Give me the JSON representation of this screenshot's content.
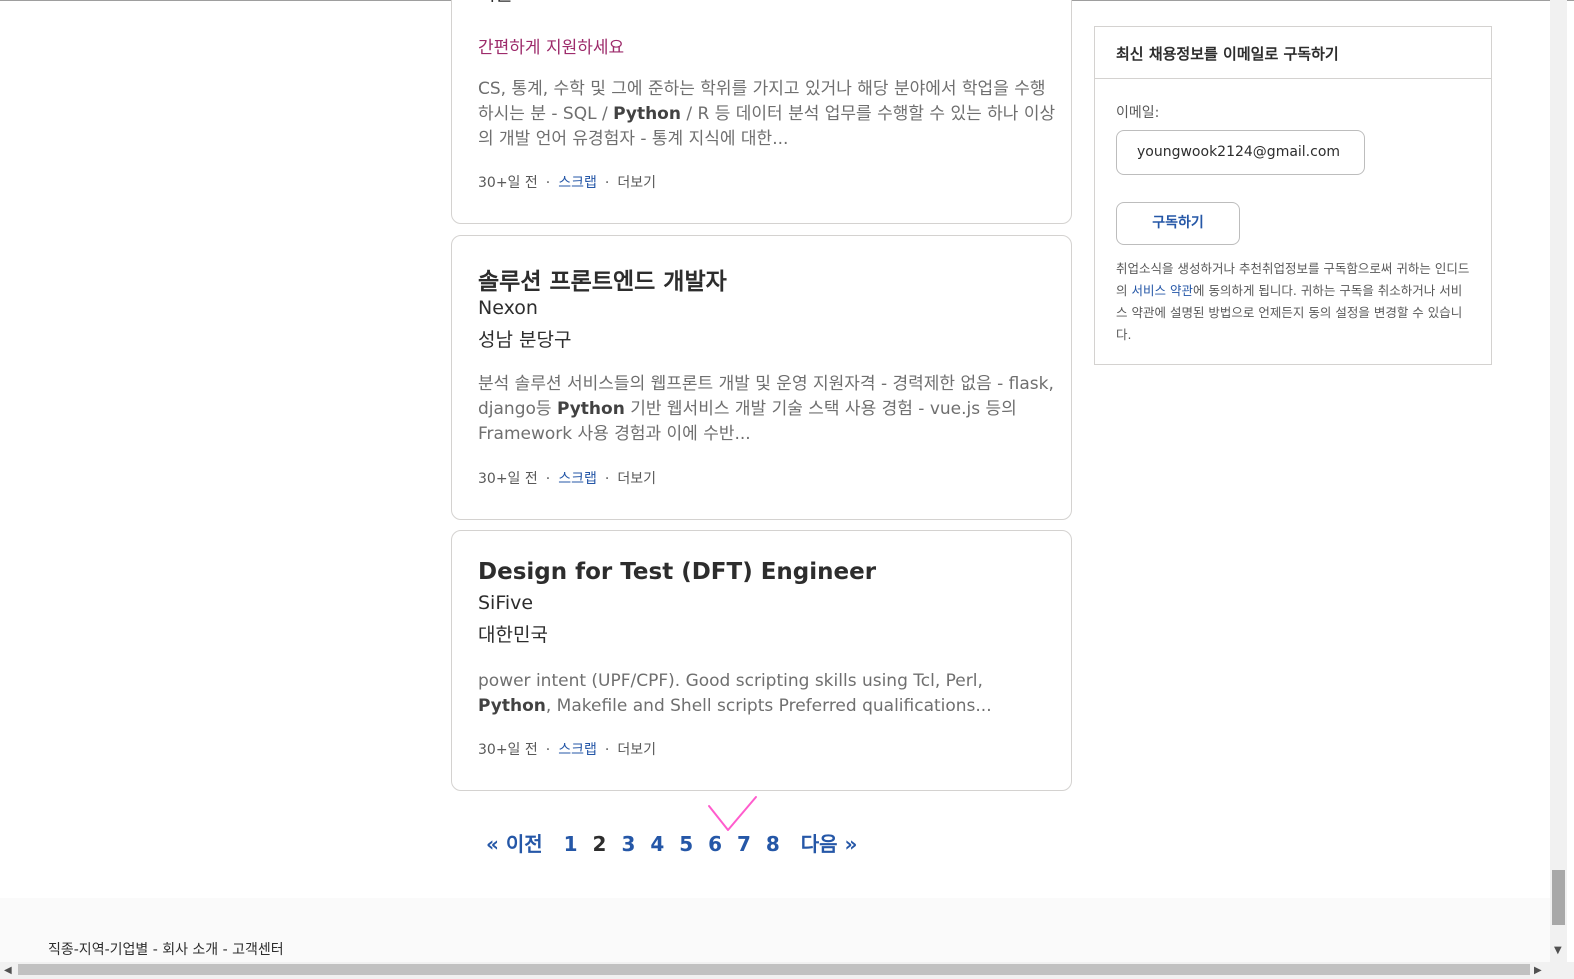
{
  "jobs": [
    {
      "location_partial": "서울",
      "easy_apply": "간편하게 지원하세요",
      "snippet": {
        "a": "CS, 통계, 수학 및 그에 준하는 학위를 가지고 있거나 해당 분야에서 학업을 수행하시는 분 - SQL / ",
        "b": "Python",
        "c": " / R 등 데이터 분석 업무를 수행할 수 있는 하나 이상의 개발 언어 유경험자 - 통계 지식에 대한..."
      },
      "age": "30+일 전",
      "save": "스크랩",
      "more": "더보기"
    },
    {
      "title": "솔루션 프론트엔드 개발자",
      "company": "Nexon",
      "location": "성남 분당구",
      "snippet": {
        "a": "분석 솔루션 서비스들의 웹프론트 개발 및 운영 지원자격 - 경력제한 없음 - flask, django등 ",
        "b": "Python",
        "c": " 기반 웹서비스 개발 기술 스택 사용 경험 - vue.js 등의 Framework 사용 경험과 이에 수반..."
      },
      "age": "30+일 전",
      "save": "스크랩",
      "more": "더보기"
    },
    {
      "title": "Design for Test (DFT) Engineer",
      "company": "SiFive",
      "location": "대한민국",
      "snippet": {
        "a": "power intent (UPF/CPF). Good scripting skills using Tcl, Perl, ",
        "b": "Python",
        "c": ", Makefile and Shell scripts Preferred qualifications..."
      },
      "age": "30+일 전",
      "save": "스크랩",
      "more": "더보기"
    }
  ],
  "pagination": {
    "prev": "« 이전",
    "pages": [
      "1",
      "2",
      "3",
      "4",
      "5",
      "6",
      "7",
      "8"
    ],
    "current": "2",
    "next": "다음 »"
  },
  "subscribe": {
    "heading": "최신 채용정보를 이메일로 구독하기",
    "email_label": "이메일:",
    "email_value": "youngwook2124@gmail.com",
    "button": "구독하기",
    "note_before": "취업소식을 생성하거나 추천취업정보를 구독함으로써 귀하는 인디드의 ",
    "note_link": "서비스 약관",
    "note_after": "에 동의하게 됩니다. 귀하는 구독을 취소하거나 서비스 약관에 설명된 방법으로 언제든지 동의 설정을 변경할 수 있습니다."
  },
  "footer": {
    "text": "직종-지역-기업별 - 회사 소개 - 고객센터"
  },
  "colors": {
    "link": "#2557a7",
    "easy_apply": "#9d2b6b",
    "annotation_check": "#ff5ccd"
  }
}
